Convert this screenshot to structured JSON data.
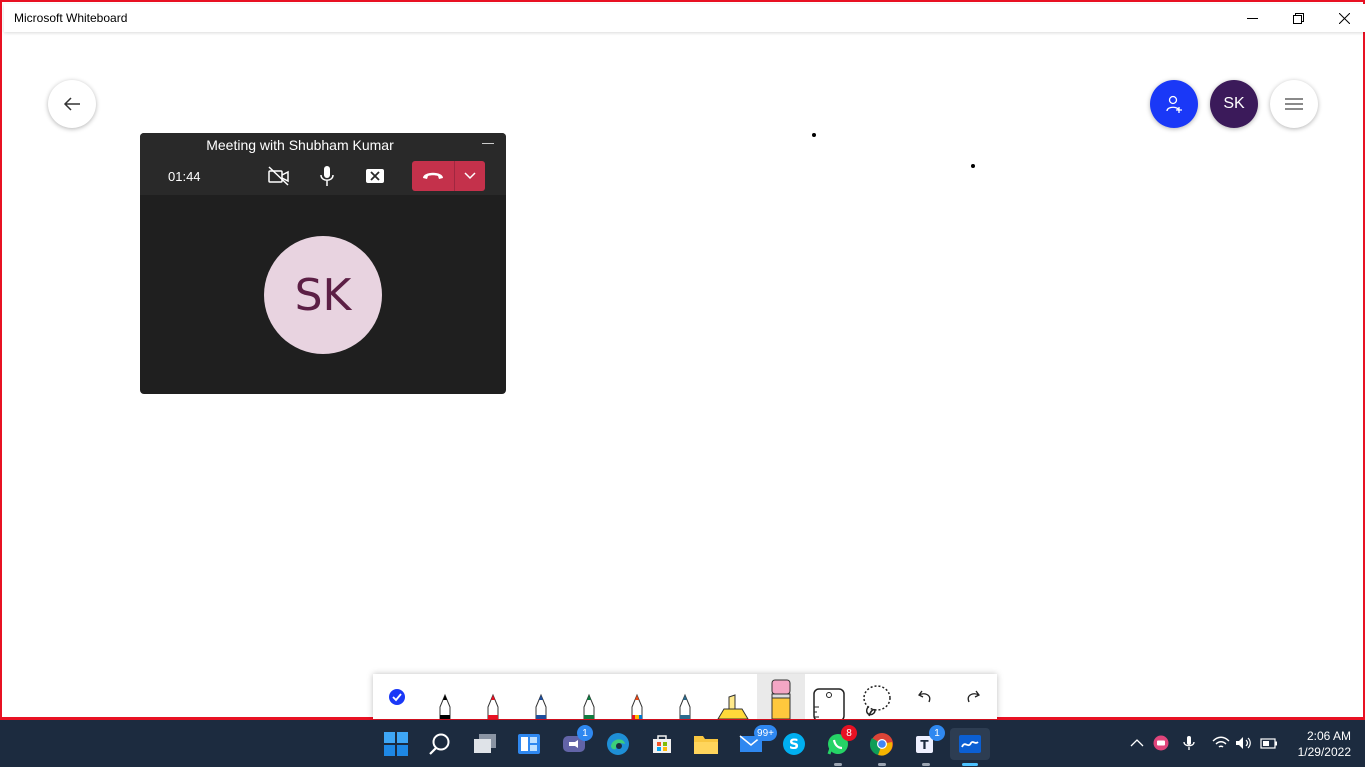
{
  "window": {
    "title": "Microsoft Whiteboard",
    "controls": [
      "minimize-icon",
      "restore-icon",
      "close-icon"
    ]
  },
  "header": {
    "back_icon": "arrow-left-icon",
    "invite_icon": "person-add-icon",
    "user_initials": "SK",
    "menu_icon": "hamburger-menu-icon",
    "invite_color": "#1a38f7",
    "avatar_color": "#3b1a5a"
  },
  "meeting": {
    "title": "Meeting with Shubham Kumar",
    "timer": "01:44",
    "participant_initials": "SK",
    "controls": [
      "video-off-icon",
      "microphone-icon",
      "share-stop-icon",
      "hang-up-icon",
      "chevron-down-icon"
    ],
    "hangup_color": "#c4314b"
  },
  "toolbar": {
    "tools": [
      {
        "name": "select-tool",
        "icon": "checkmark-circle-icon",
        "color": "#1a38f7"
      },
      {
        "name": "pen-black",
        "icon": "pen-icon",
        "color": "#000000"
      },
      {
        "name": "pen-red",
        "icon": "pen-icon",
        "color": "#e81123"
      },
      {
        "name": "pen-blue",
        "icon": "pen-icon",
        "color": "#1f4e9c"
      },
      {
        "name": "pen-green",
        "icon": "pen-icon",
        "color": "#107c41"
      },
      {
        "name": "pen-rainbow",
        "icon": "pen-icon",
        "color": "#e84b1a"
      },
      {
        "name": "pen-galaxy",
        "icon": "pen-icon",
        "color": "#2d6a8c"
      },
      {
        "name": "highlighter-yellow",
        "icon": "highlighter-icon",
        "color": "#ffd83a"
      },
      {
        "name": "eraser",
        "icon": "eraser-icon",
        "color": "#f3a6c5"
      },
      {
        "name": "ruler",
        "icon": "ruler-icon",
        "color": "#000000"
      },
      {
        "name": "lasso",
        "icon": "lasso-icon",
        "color": "#000000"
      },
      {
        "name": "undo",
        "icon": "undo-icon",
        "color": "#000000"
      },
      {
        "name": "redo",
        "icon": "redo-icon",
        "color": "#000000"
      }
    ]
  },
  "taskbar": {
    "apps": [
      {
        "name": "start",
        "icon": "windows-logo-icon"
      },
      {
        "name": "search",
        "icon": "search-icon"
      },
      {
        "name": "task-view",
        "icon": "task-view-icon"
      },
      {
        "name": "widgets",
        "icon": "widgets-icon"
      },
      {
        "name": "teams-chat",
        "icon": "teams-chat-icon",
        "badge": "1"
      },
      {
        "name": "edge",
        "icon": "edge-icon"
      },
      {
        "name": "store",
        "icon": "store-icon"
      },
      {
        "name": "file-explorer",
        "icon": "folder-icon"
      },
      {
        "name": "mail",
        "icon": "mail-icon",
        "badge": "99+"
      },
      {
        "name": "skype",
        "icon": "skype-icon"
      },
      {
        "name": "whatsapp",
        "icon": "whatsapp-icon",
        "badge": "8"
      },
      {
        "name": "chrome",
        "icon": "chrome-icon"
      },
      {
        "name": "teams",
        "icon": "teams-icon",
        "badge": "1"
      },
      {
        "name": "whiteboard",
        "icon": "whiteboard-icon"
      }
    ],
    "tray": [
      "chevron-up-icon",
      "meet-now-icon",
      "microphone-icon",
      "wifi-icon",
      "volume-icon",
      "battery-icon"
    ],
    "time": "2:06 AM",
    "date": "1/29/2022"
  }
}
